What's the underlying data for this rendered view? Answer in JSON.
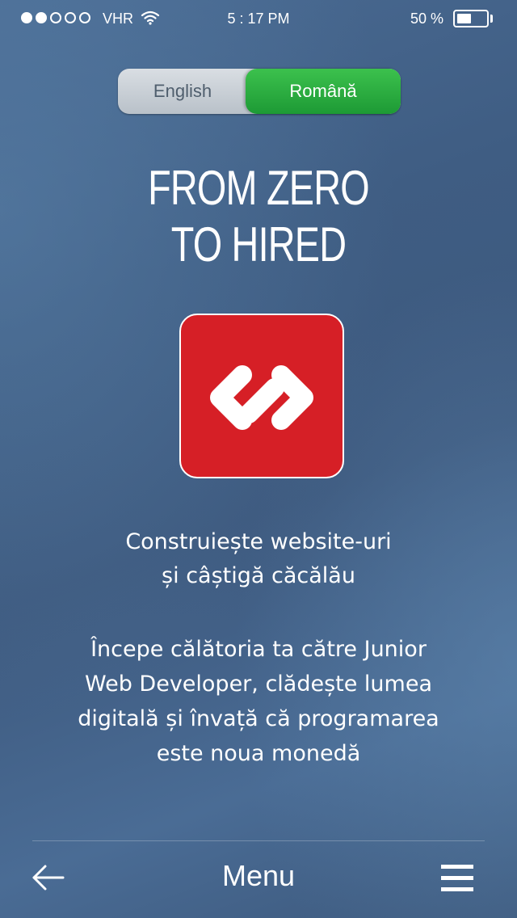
{
  "status_bar": {
    "signal_bars_filled": 2,
    "signal_bars_total": 5,
    "carrier": "VHR",
    "wifi_icon": "wifi-icon",
    "time": "5 : 17 PM",
    "battery_percent_text": "50 %",
    "battery_level": 0.5
  },
  "language_toggle": {
    "options": [
      "English",
      "Română"
    ],
    "selected": "Română",
    "english_label": "English",
    "romana_label": "Română",
    "active_color": "#25a83c"
  },
  "title": {
    "line1": "FROM ZERO",
    "line2": "TO HIRED"
  },
  "logo": {
    "icon": "code-brackets-icon",
    "background_color": "#d61f26"
  },
  "tagline": {
    "line1": "Construiește website-uri",
    "line2": "și câștigă căcălău"
  },
  "description": {
    "line1": "Începe călătoria ta către Junior",
    "line2": "Web Developer, clădește lumea",
    "line3": "digitală și învață că programarea",
    "line4": "este noua monedă"
  },
  "bottom_nav": {
    "back_icon": "arrow-left-icon",
    "menu_label": "Menu",
    "menu_icon": "hamburger-icon"
  }
}
